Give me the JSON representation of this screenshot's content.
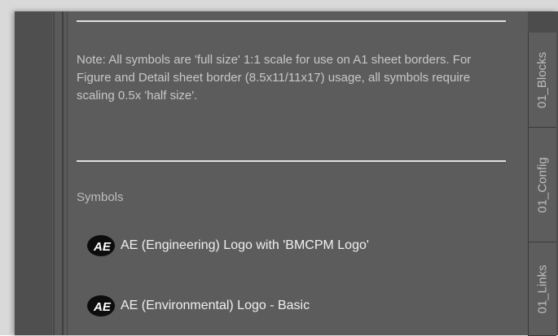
{
  "note": "Note: All symbols are 'full size' 1:1 scale for use on A1 sheet borders. For Figure and Detail sheet border (8.5x11/11x17) usage,  all symbols require scaling 0.5x 'half size'.",
  "section_title": "Symbols",
  "symbols": [
    {
      "label": "AE (Engineering) Logo with 'BMCPM Logo'",
      "icon": "ae-logo-icon"
    },
    {
      "label": "AE (Environmental) Logo - Basic",
      "icon": "ae-logo-icon"
    }
  ],
  "tabs": [
    {
      "label": "01_Blocks"
    },
    {
      "label": "01_Config"
    },
    {
      "label": "01_Links"
    }
  ],
  "colors": {
    "panel_background": "#5c5c5c",
    "text": "#c8c8c8",
    "divider": "#e0e0e0"
  }
}
